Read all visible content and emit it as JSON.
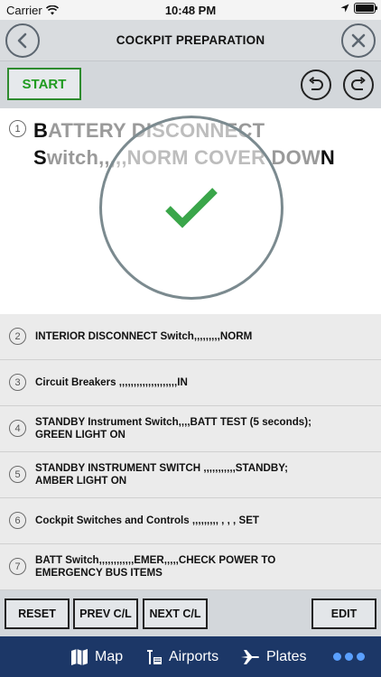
{
  "status_bar": {
    "carrier": "Carrier",
    "time": "10:48 PM",
    "battery_level": 1.0
  },
  "header": {
    "title": "COCKPIT PREPARATION"
  },
  "toolbar": {
    "start_label": "START"
  },
  "active_item": {
    "number": "1",
    "text_first": "B",
    "text_middle": "ATTERY DISCONNECT",
    "text_line2_first": "S",
    "text_line2_middle": "witch,,,,,NORM COVER DOW",
    "text_last": "N",
    "status": "completed"
  },
  "items": [
    {
      "number": "2",
      "line1": "INTERIOR DISCONNECT Switch,,,,,,,,,NORM",
      "line2": ""
    },
    {
      "number": "3",
      "line1": "Circuit Breakers ,,,,,,,,,,,,,,,,,,,,IN",
      "line2": ""
    },
    {
      "number": "4",
      "line1": "STANDBY Instrument Switch,,,,BATT TEST (5 seconds);",
      "line2": "GREEN LIGHT ON"
    },
    {
      "number": "5",
      "line1": "STANDBY INSTRUMENT SWITCH ,,,,,,,,,,,STANDBY;",
      "line2": "AMBER LIGHT ON"
    },
    {
      "number": "6",
      "line1": "Cockpit Switches and Controls ,,,,,,,,, , , , SET",
      "line2": ""
    },
    {
      "number": "7",
      "line1": " BATT Switch,,,,,,,,,,,,EMER,,,,,CHECK POWER TO",
      "line2": "EMERGENCY BUS ITEMS"
    }
  ],
  "bottom_buttons": {
    "reset": "RESET",
    "prev": "PREV C/L",
    "next": "NEXT C/L",
    "edit": "EDIT"
  },
  "tabs": [
    {
      "label": "Map",
      "icon": "map-icon"
    },
    {
      "label": "Airports",
      "icon": "airport-icon"
    },
    {
      "label": "Plates",
      "icon": "plane-icon"
    },
    {
      "label": "",
      "icon": "more-dots-icon"
    }
  ],
  "colors": {
    "accent_green": "#1f9b1f",
    "check_green": "#3aa64a",
    "tab_bar": "#1c3767",
    "more_dots": "#5aa0ff"
  }
}
